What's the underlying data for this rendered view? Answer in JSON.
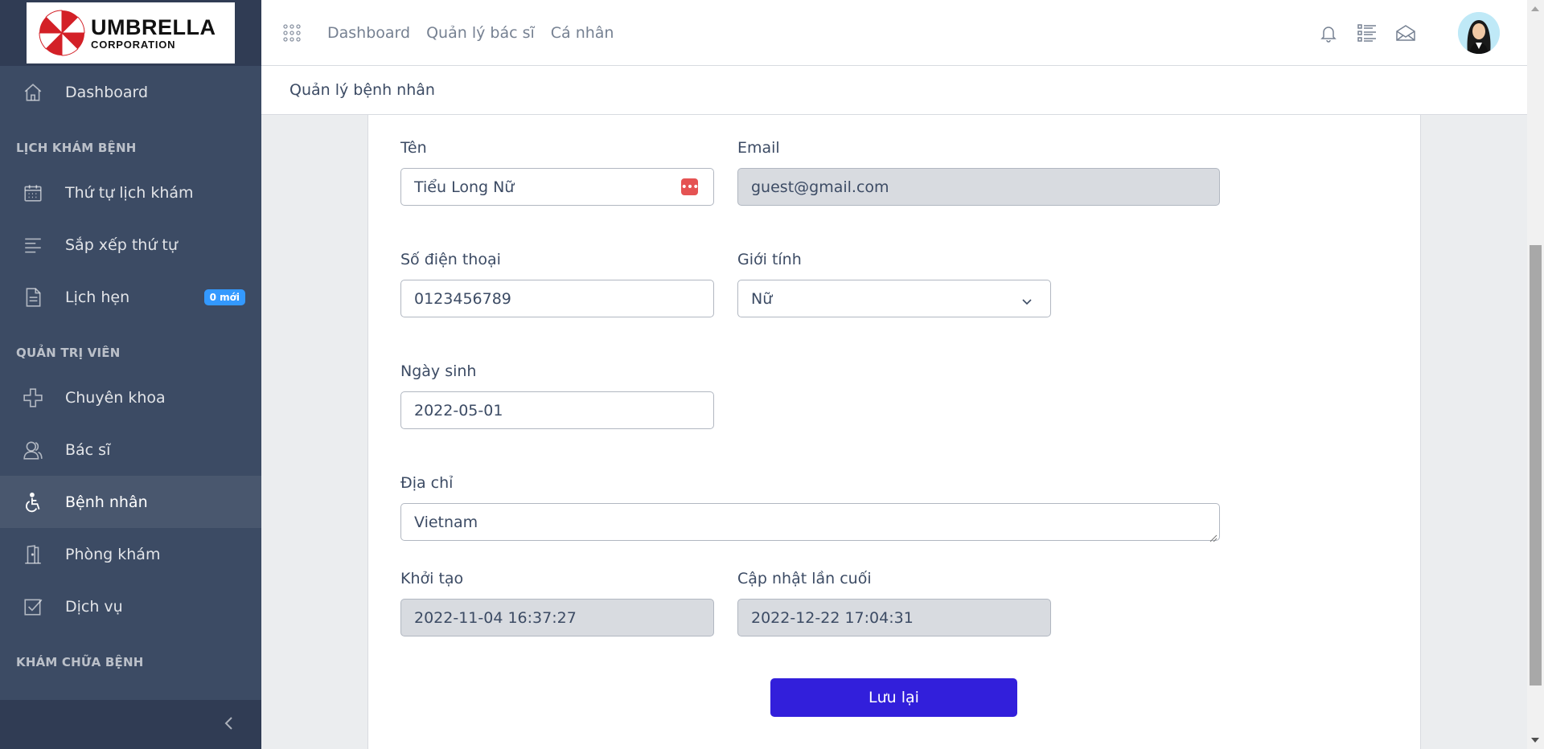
{
  "brand": {
    "name": "UMBRELLA",
    "sub": "CORPORATION"
  },
  "sidebar": {
    "dashboard": "Dashboard",
    "section1": "LỊCH KHÁM BỆNH",
    "items1": [
      {
        "label": "Thứ tự lịch khám",
        "icon": "calendar-icon"
      },
      {
        "label": "Sắp xếp thứ tự",
        "icon": "align-left-icon"
      },
      {
        "label": "Lịch hẹn",
        "icon": "file-icon",
        "badge": "0 mới"
      }
    ],
    "section2": "QUẢN TRỊ VIÊN",
    "items2": [
      {
        "label": "Chuyên khoa",
        "icon": "plus-icon"
      },
      {
        "label": "Bác sĩ",
        "icon": "people-icon"
      },
      {
        "label": "Bệnh nhân",
        "icon": "accessible-icon",
        "active": true
      },
      {
        "label": "Phòng khám",
        "icon": "door-icon"
      },
      {
        "label": "Dịch vụ",
        "icon": "task-icon"
      }
    ],
    "section3": "KHÁM CHỮA BỆNH"
  },
  "header": {
    "links": [
      "Dashboard",
      "Quản lý bác sĩ",
      "Cá nhân"
    ]
  },
  "subheader": {
    "breadcrumb": "Quản lý bệnh nhân"
  },
  "form": {
    "name_label": "Tên",
    "name_value": "Tiểu Long Nữ",
    "email_label": "Email",
    "email_value": "guest@gmail.com",
    "phone_label": "Số điện thoại",
    "phone_value": "0123456789",
    "gender_label": "Giới tính",
    "gender_value": "Nữ",
    "dob_label": "Ngày sinh",
    "dob_value": "2022-05-01",
    "address_label": "Địa chỉ",
    "address_value": "Vietnam",
    "created_label": "Khởi tạo",
    "created_value": "2022-11-04 16:37:27",
    "updated_label": "Cập nhật lần cuối",
    "updated_value": "2022-12-22 17:04:31",
    "save_label": "Lưu lại"
  },
  "colors": {
    "sidebar": "#3c4b64",
    "primary": "#321fdb",
    "badge": "#3399ff",
    "danger": "#e55353"
  }
}
